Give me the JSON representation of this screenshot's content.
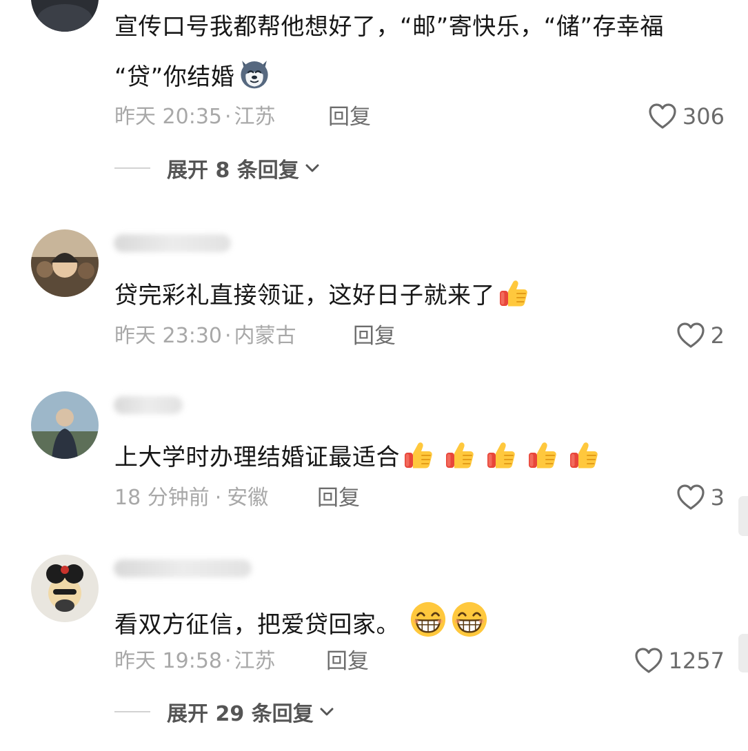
{
  "comments": [
    {
      "username": "",
      "text": "宣传口号我都帮他想好了，“邮”寄快乐，“储”存幸福",
      "text_line2": "“贷”你结婚",
      "emojis": [
        "husky-emoji"
      ],
      "time": "昨天 20:35",
      "location": "江苏",
      "reply_label": "回复",
      "likes": "306",
      "expand_label": "展开 8 条回复"
    },
    {
      "username": "",
      "text": "贷完彩礼直接领证，这好日子就来了",
      "emojis": [
        "thumbs-up-emoji"
      ],
      "time": "昨天 23:30",
      "location": "内蒙古",
      "reply_label": "回复",
      "likes": "2"
    },
    {
      "username": "",
      "text": "上大学时办理结婚证最适合",
      "emojis": [
        "thumbs-up-emoji",
        "thumbs-up-emoji",
        "thumbs-up-emoji",
        "thumbs-up-emoji",
        "thumbs-up-emoji"
      ],
      "time": "18 分钟前",
      "location": "安徽",
      "reply_label": "回复",
      "likes": "3"
    },
    {
      "username": "",
      "text": "看双方征信，把爱贷回家。",
      "emojis": [
        "grin-emoji",
        "grin-emoji"
      ],
      "time": "昨天 19:58",
      "location": "江苏",
      "reply_label": "回复",
      "likes": "1257",
      "expand_label": "展开 29 条回复"
    }
  ],
  "colors": {
    "text": "#161616",
    "meta": "#a8a8a8",
    "reply": "#6d6d6d",
    "icon": "#6b6b6b"
  },
  "separator": "·"
}
